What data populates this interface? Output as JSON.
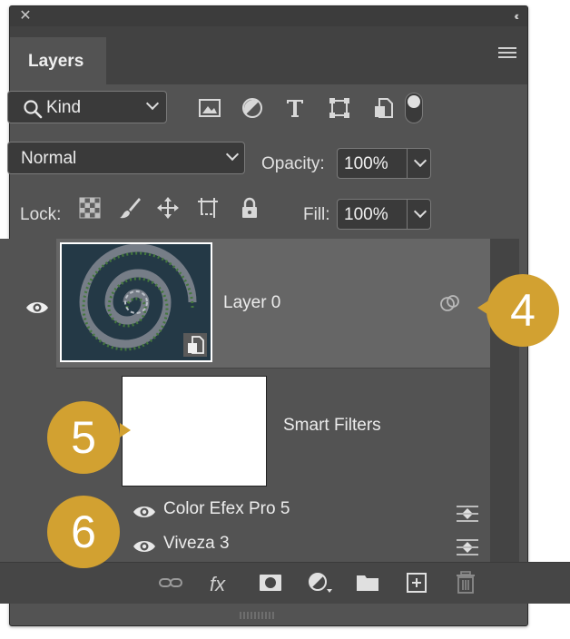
{
  "panel": {
    "tab_label": "Layers"
  },
  "filter_bar": {
    "kind_label": "Kind"
  },
  "blend_bar": {
    "blend_mode": "Normal",
    "opacity_label": "Opacity:",
    "opacity_value": "100%"
  },
  "lock_bar": {
    "lock_label": "Lock:",
    "fill_label": "Fill:",
    "fill_value": "100%"
  },
  "layers": {
    "layer0_name": "Layer 0",
    "smart_filters_label": "Smart Filters",
    "filters": [
      {
        "name": "Color Efex Pro 5"
      },
      {
        "name": "Viveza 3"
      }
    ]
  },
  "bottom_bar": {
    "fx_label": "fx"
  },
  "callouts": [
    {
      "number": "4"
    },
    {
      "number": "5"
    },
    {
      "number": "6"
    }
  ],
  "colors": {
    "panel_bg": "#535353",
    "selected_row": "#666666",
    "callout": "#d2a131"
  }
}
